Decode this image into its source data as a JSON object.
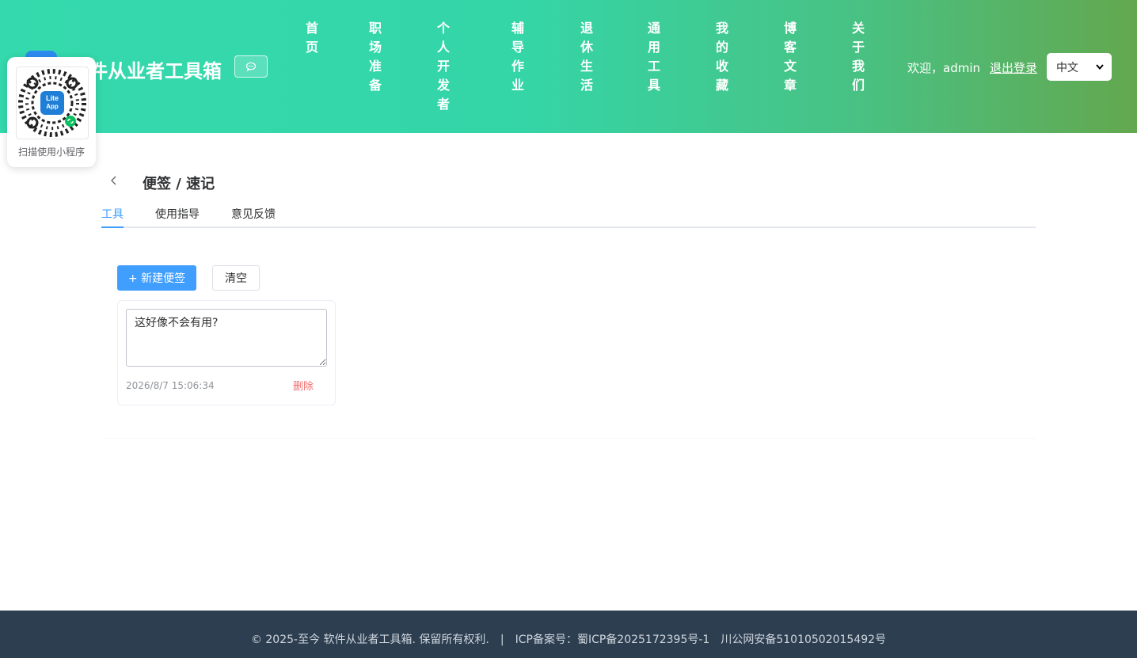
{
  "header": {
    "logo_icon": "liteapp-logo-icon",
    "site_title": "件从业者工具箱",
    "chat_icon": "chat-bubble-icon",
    "nav": [
      {
        "label": "首页"
      },
      {
        "label": "职场准备"
      },
      {
        "label": "个人开发者"
      },
      {
        "label": "辅导作业"
      },
      {
        "label": "退休生活"
      },
      {
        "label": "通用工具"
      },
      {
        "label": "我的收藏"
      },
      {
        "label": "博客文章"
      },
      {
        "label": "关于我们"
      }
    ],
    "welcome": "欢迎，admin",
    "logout": "退出登录",
    "language": {
      "selected": "中文"
    }
  },
  "qr_popup": {
    "caption": "扫描使用小程序",
    "badge": "Lite App"
  },
  "page": {
    "title": "便签 / 速记",
    "tabs": [
      {
        "label": "工具",
        "active": true
      },
      {
        "label": "使用指导",
        "active": false
      },
      {
        "label": "意见反馈",
        "active": false
      }
    ]
  },
  "toolbar": {
    "new_note": "+ 新建便签",
    "clear": "清空"
  },
  "notes": [
    {
      "text": "这好像不会有用?",
      "time": "2026/8/7 15:06:34",
      "delete": "删除"
    }
  ],
  "footer": {
    "copyright": "© 2025-至今 软件从业者工具箱. 保留所有权利.",
    "separator": "|",
    "icp": "ICP备案号：蜀ICP备2025172395号-1",
    "police": "川公网安备51010502015492号"
  },
  "colors": {
    "accent": "#409eff",
    "danger": "#f56c6c",
    "header_start": "#34d9ad",
    "header_end": "#63a84f",
    "footer_bg": "#2c3e50"
  }
}
